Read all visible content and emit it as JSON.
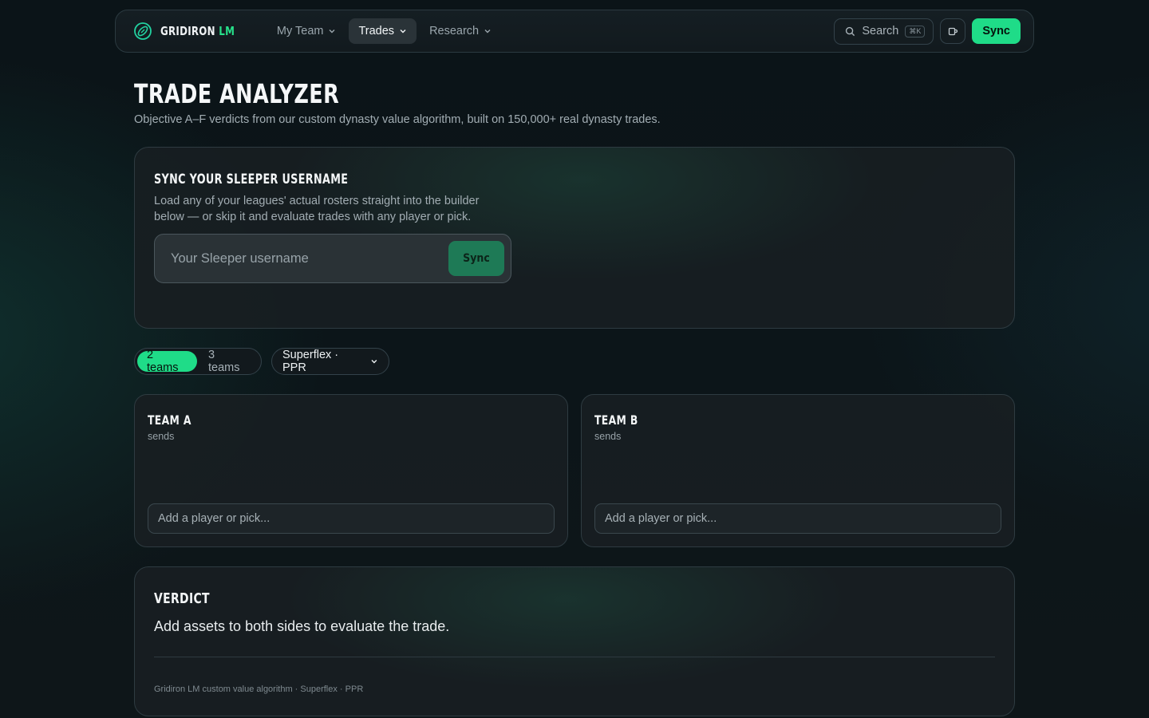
{
  "nav": {
    "brand_main": "GRIDIRON",
    "brand_accent": "LM",
    "items": [
      {
        "label": "My Team",
        "active": false
      },
      {
        "label": "Trades",
        "active": true
      },
      {
        "label": "Research",
        "active": false
      }
    ],
    "search_label": "Search",
    "search_shortcut": "⌘K",
    "sync_label": "Sync"
  },
  "header": {
    "title": "TRADE ANALYZER",
    "subtitle": "Objective A–F verdicts from our custom dynasty value algorithm, built on 150,000+ real dynasty trades."
  },
  "sync_card": {
    "title": "SYNC YOUR SLEEPER USERNAME",
    "description": "Load any of your leagues' actual rosters straight into the builder below — or skip it and evaluate trades with any player or pick.",
    "input_value": "",
    "input_placeholder": "Your Sleeper username",
    "button_label": "Sync"
  },
  "controls": {
    "team_count_options": [
      "2 teams",
      "3 teams"
    ],
    "team_count_selected": "2 teams",
    "format_label": "Superflex · PPR"
  },
  "teams": [
    {
      "name": "TEAM A",
      "role": "sends",
      "input_value": "",
      "input_placeholder": "Add a player or pick..."
    },
    {
      "name": "TEAM B",
      "role": "sends",
      "input_value": "",
      "input_placeholder": "Add a player or pick..."
    }
  ],
  "verdict": {
    "title": "VERDICT",
    "message": "Add assets to both sides to evaluate the trade.",
    "footer": "Gridiron LM custom value algorithm · Superflex · PPR"
  },
  "colors": {
    "accent": "#1fdc88",
    "background": "#0c1519",
    "card": "#181e22",
    "muted_sync_button": "#1e7a56"
  },
  "icons": [
    "football-logo-icon",
    "chevron-down-icon",
    "search-icon",
    "mug-icon"
  ]
}
